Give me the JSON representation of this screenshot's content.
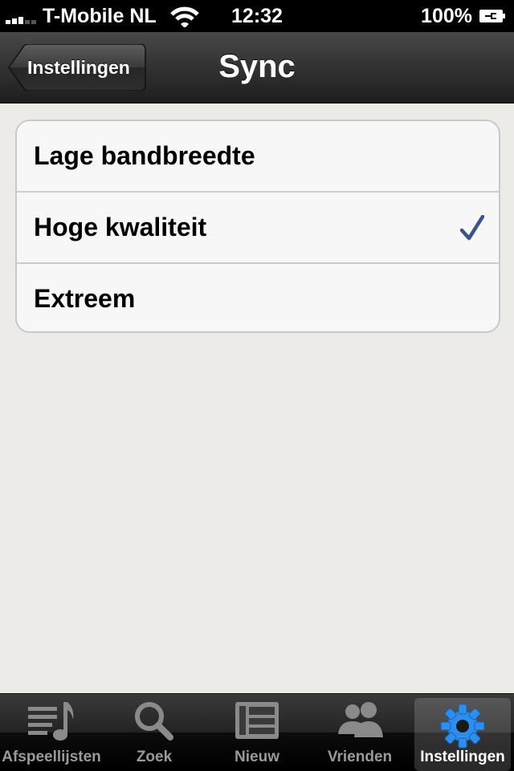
{
  "status_bar": {
    "carrier": "T-Mobile NL",
    "time": "12:32",
    "battery_percent": "100%",
    "icons": [
      "signal-icon",
      "wifi-icon",
      "battery-charging-icon"
    ]
  },
  "nav_bar": {
    "back_label": "Instellingen",
    "title": "Sync"
  },
  "options": [
    {
      "label": "Lage bandbreedte",
      "selected": false
    },
    {
      "label": "Hoge kwaliteit",
      "selected": true
    },
    {
      "label": "Extreem",
      "selected": false
    }
  ],
  "tab_bar": {
    "tabs": [
      {
        "label": "Afspeellijsten",
        "icon": "playlist-note-icon",
        "selected": false
      },
      {
        "label": "Zoek",
        "icon": "magnifier-icon",
        "selected": false
      },
      {
        "label": "Nieuw",
        "icon": "news-icon",
        "selected": false
      },
      {
        "label": "Vrienden",
        "icon": "people-icon",
        "selected": false
      },
      {
        "label": "Instellingen",
        "icon": "gear-icon",
        "selected": true
      }
    ]
  },
  "colors": {
    "background": "#ecebe7",
    "checkmark": "#38558a",
    "selected_tab_icon": "#2c8ff0"
  }
}
